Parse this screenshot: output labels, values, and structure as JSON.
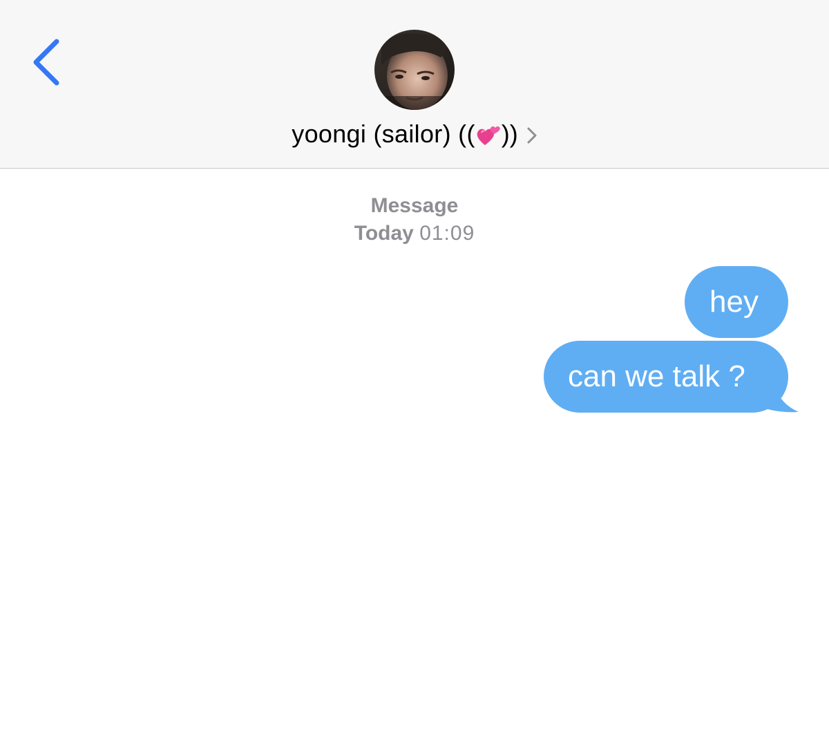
{
  "header": {
    "back_icon": "chevron-left-icon",
    "contact": {
      "avatar_description": "contact-avatar-photo",
      "name_prefix": "yoongi (sailor) ((",
      "emoji_icon": "two-hearts-emoji",
      "name_suffix": "))",
      "chevron_icon": "chevron-right-icon"
    }
  },
  "conversation": {
    "service_label": "Message",
    "day_label": "Today",
    "time_label": "01:09",
    "messages": [
      {
        "text": "hey",
        "sender": "me"
      },
      {
        "text": "can we talk ?",
        "sender": "me"
      }
    ]
  },
  "colors": {
    "accent_blue": "#3478f6",
    "bubble_blue": "#5faef3",
    "header_bg": "#f7f7f7",
    "timestamp_gray": "#8e8e93"
  }
}
